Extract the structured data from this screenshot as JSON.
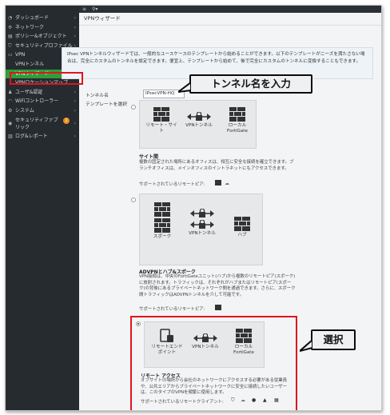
{
  "sidebar": {
    "items": [
      {
        "label": "ダッシュボード",
        "icon": "dashboard-icon",
        "glyph": "◔",
        "chevron": "›"
      },
      {
        "label": "ネットワーク",
        "icon": "network-icon",
        "glyph": "✣",
        "chevron": "›"
      },
      {
        "label": "ポリシー&オブジェクト",
        "icon": "policy-icon",
        "glyph": "▤",
        "chevron": "›"
      },
      {
        "label": "セキュリティプロファイル",
        "icon": "shield-icon",
        "glyph": "⛉",
        "chevron": "›"
      },
      {
        "label": "VPN",
        "icon": "vpn-icon",
        "glyph": "▭",
        "chevron": "⌄"
      }
    ],
    "sub_items": [
      {
        "label": "VPNトンネル"
      },
      {
        "label": "VPNウィザード",
        "active": true
      },
      {
        "label": "VPNロケーションマップ"
      }
    ],
    "items_after": [
      {
        "label": "ユーザ&認証",
        "icon": "user-icon",
        "glyph": "♟",
        "chevron": "›"
      },
      {
        "label": "WiFiコントローラー",
        "icon": "wifi-icon",
        "glyph": "◠",
        "chevron": "›"
      },
      {
        "label": "システム",
        "icon": "gear-icon",
        "glyph": "⚙",
        "chevron": "›"
      },
      {
        "label": "セキュリティファブリック",
        "icon": "fabric-icon",
        "glyph": "◉",
        "chevron": "›",
        "badge": "1"
      },
      {
        "label": "ログ&レポート",
        "icon": "report-icon",
        "glyph": "▥",
        "chevron": "›"
      }
    ],
    "star": "☆"
  },
  "topbar": {
    "menu_glyph": "≡",
    "search_glyph": "⚲▾"
  },
  "page": {
    "title": "VPNウィザード"
  },
  "notice": {
    "text": "IPsec VPNトンネルウィザードでは、一般的なユースケースのテンプレートから始めることができます。以下のテンプレートがニーズを満たさない場合は、完全にカスタムのトンネルを設定できます。便宜上、テンプレートから始めて、後で完全にカスタムのトンネルに変換することもできます。"
  },
  "form": {
    "tunnel_name_label": "トンネル名",
    "tunnel_name_value": "IPsecVPN-HQ",
    "template_label": "テンプレートを選択"
  },
  "callouts": {
    "tunnel_name": "トンネル名を入力",
    "select": "選択"
  },
  "templates": [
    {
      "nodes": [
        "リモート・サイト",
        "VPNトンネル",
        "ローカル\nFortiGate"
      ],
      "title": "サイト間",
      "description": "複数の固定された場所にあるオフィスは、相互に安全な接続を確立できます。ブランチオフィスは、メインオフィスのイントラネットにもアクセスできます。",
      "peer_label": "サポートされているリモートピア:",
      "selected": false
    },
    {
      "nodes": [
        "スポーク",
        "VPNトンネル",
        "ハブ"
      ],
      "title": "ADVPNとハブ&スポーク",
      "description": "VPN接続は、中央のFortiGateユニット(ハブ)から複数のリモートピア(スポーク)に放射されます。トラフィックは、それぞれがハブまたはリモートピア(スポーク)の背後にあるプライベートネットワーク間を通過できます。さらに、スポーク間トラフィックはADVPNトンネルを介して可能です。",
      "peer_label": "サポートされているリモートピア:",
      "selected": false
    },
    {
      "nodes": [
        "リモートエンド\nポイント",
        "VPNトンネル",
        "ローカル\nFortiGate"
      ],
      "title": "リモート アクセス",
      "description": "オフサイトの場所から会社のネットワークにアクセスする必要がある従業員や、公共エリアからプライベートネットワークに安全に接続したいユーザーは、このタイプのVPNを頻繁に使用します。",
      "peer_label": "サポートされているリモートクライアント:",
      "selected": true
    }
  ]
}
